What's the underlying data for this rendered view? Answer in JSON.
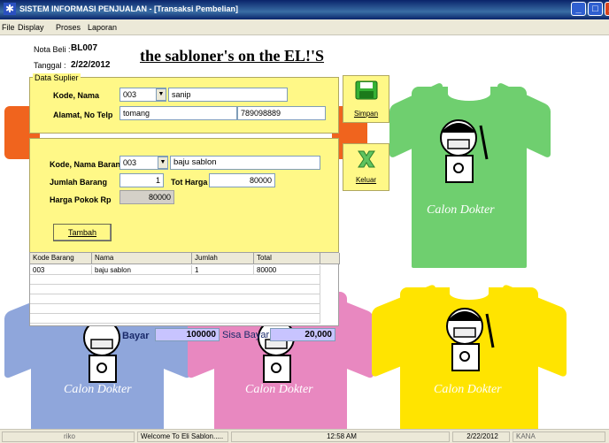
{
  "window": {
    "title": "SISTEM INFORMASI PENJUALAN - [Transaksi Pembelian]",
    "min_label": "_",
    "max_label": "□",
    "close_label": "X"
  },
  "menu": [
    "File",
    "Display",
    "Proses",
    "Laporan"
  ],
  "header": {
    "nota_label": "Nota Beli :",
    "nota_value": "BL007",
    "tanggal_label": "Tanggal :",
    "tanggal_value": "2/22/2012",
    "banner": "the sabloner's on the EL!'S"
  },
  "supplier": {
    "group_label": "Data Suplier",
    "kode_nama_label": "Kode, Nama",
    "kode_value": "003",
    "nama_value": "sanip",
    "alamat_label": "Alamat, No Telp",
    "alamat_value": "tomang",
    "telp_value": "789098889"
  },
  "barang": {
    "kode_nama_label": "Kode, Nama Barang",
    "kode_value": "003",
    "nama_value": "baju sablon",
    "jumlah_label": "Jumlah Barang",
    "jumlah_value": "1",
    "tot_harga_label": "Tot Harga",
    "tot_harga_value": "80000",
    "harga_pokok_label": "Harga Pokok Rp",
    "harga_pokok_value": "80000",
    "tambah_label": "Tambah"
  },
  "buttons": {
    "simpan_label": "Simpan",
    "keluar_label": "Keluar"
  },
  "table": {
    "columns": [
      "Kode Barang",
      "Nama",
      "Jumlah",
      "Total"
    ],
    "rows": [
      [
        "003",
        "baju sablon",
        "1",
        "80000"
      ]
    ]
  },
  "payment": {
    "bayar_label": "Bayar",
    "bayar_value": "100000",
    "sisa_label": "Sisa Bayar",
    "sisa_value": "20,000"
  },
  "shirts": {
    "caption": "Calon Dokter"
  },
  "status": {
    "user": "riko",
    "welcome": "Welcome To Eli Sablon.....",
    "time": "12:58 AM",
    "date": "2/22/2012",
    "kana": "KANA"
  },
  "colors": {
    "panel": "#fff887",
    "green_shirt": "#6fcf6f",
    "orange_shirt": "#f0641e",
    "blue_shirt": "#8fa6db",
    "pink_shirt": "#e888c0",
    "yellow_shirt": "#ffe400",
    "titlebar": "#0a246a"
  }
}
